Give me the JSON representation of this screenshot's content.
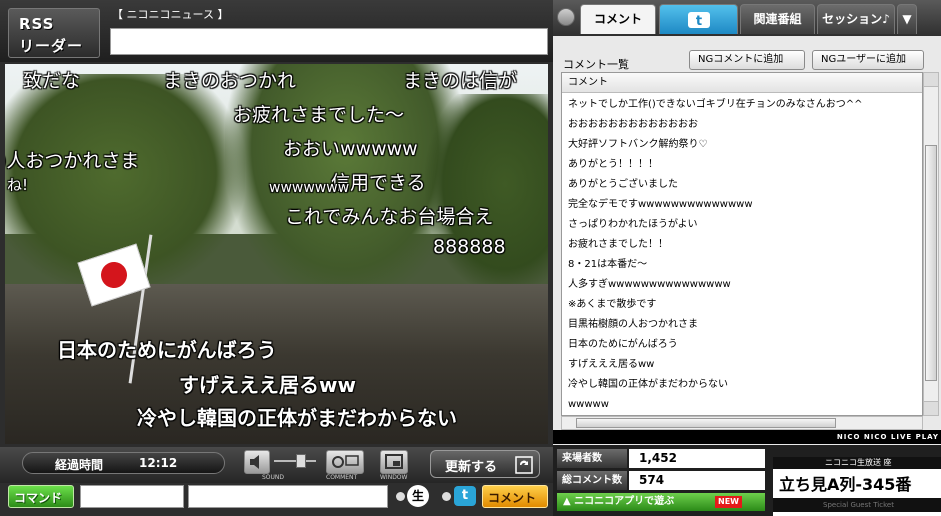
{
  "rss": {
    "logo_line1": "RSS",
    "logo_line2": "リーダー",
    "source_label": "【 ニコニコニュース 】",
    "box_text": ""
  },
  "video": {
    "comments_top": [
      "致だな",
      "まきのおつかれ",
      "まきのは信が",
      "お疲れさまでした〜",
      ")人おつかれさま",
      "おおいwwwww",
      "信用できる",
      "wwwwwww",
      "これでみんなお台場合え",
      "888888",
      "ね!"
    ],
    "comments_bottom": [
      "日本のためにがんばろう",
      "すげえええ居るww",
      "冷やし韓国の正体がまだわからない"
    ]
  },
  "controls": {
    "elapsed_label": "経過時間",
    "elapsed_time": "12:12",
    "sound_label": "SOUND",
    "comment_label": "COMMENT",
    "window_label": "WINDOW",
    "refresh_label": "更新する",
    "command_button": "コマンド",
    "command_value": "",
    "comment_value": "",
    "nama_icon": "生",
    "twitter_icon": "t",
    "send_button": "コメント"
  },
  "tabs": [
    {
      "label": "コメント",
      "active": true
    },
    {
      "label": "",
      "icon": "twitter-icon"
    },
    {
      "label": "関連番組"
    },
    {
      "label": "セッション♪"
    },
    {
      "label": "▼"
    }
  ],
  "comment_panel": {
    "title": "コメント一覧",
    "ng_comment_button": "NGコメントに追加",
    "ng_user_button": "NGユーザーに追加",
    "column_header": "コメント",
    "rows": [
      "ネットでしか工作()できないゴキブリ在チョンのみなさんおつ^^",
      "おおおおおおおおおおおおお",
      "大好評ソフトバンク解約祭り♡",
      "ありがとう！！！！",
      "ありがとうございました",
      "完全なデモですwwwwwwwwwwwwww",
      "さっぱりわかれたほうがよい",
      "お疲れさまでした！！",
      "8・21は本番だ〜",
      "人多すぎwwwwwwwwwwwwwww",
      "※あくまで散歩です",
      "目黒祐樹顔の人おつかれさま",
      "日本のためにがんばろう",
      "すげえええ居るww",
      "冷やし韓国の正体がまだわからない",
      "wwwww"
    ]
  },
  "footer": {
    "strip_text": "NICO NICO LIVE PLAY",
    "visitors_label": "来場者数",
    "visitors_value": "1,452",
    "comments_label": "総コメント数",
    "comments_value": "574",
    "app_bar_text": "▲ ニコニコアプリで遊ぶ",
    "app_new_badge": "NEW",
    "promo_top": "ニコニコ生放送 座",
    "promo_main": "立ち見A列-345番",
    "promo_sub": "Special Guest Ticket"
  },
  "colors": {
    "accent_green": "#2c8c18",
    "accent_orange": "#e18a00",
    "twitter_blue": "#2aa5d8"
  }
}
